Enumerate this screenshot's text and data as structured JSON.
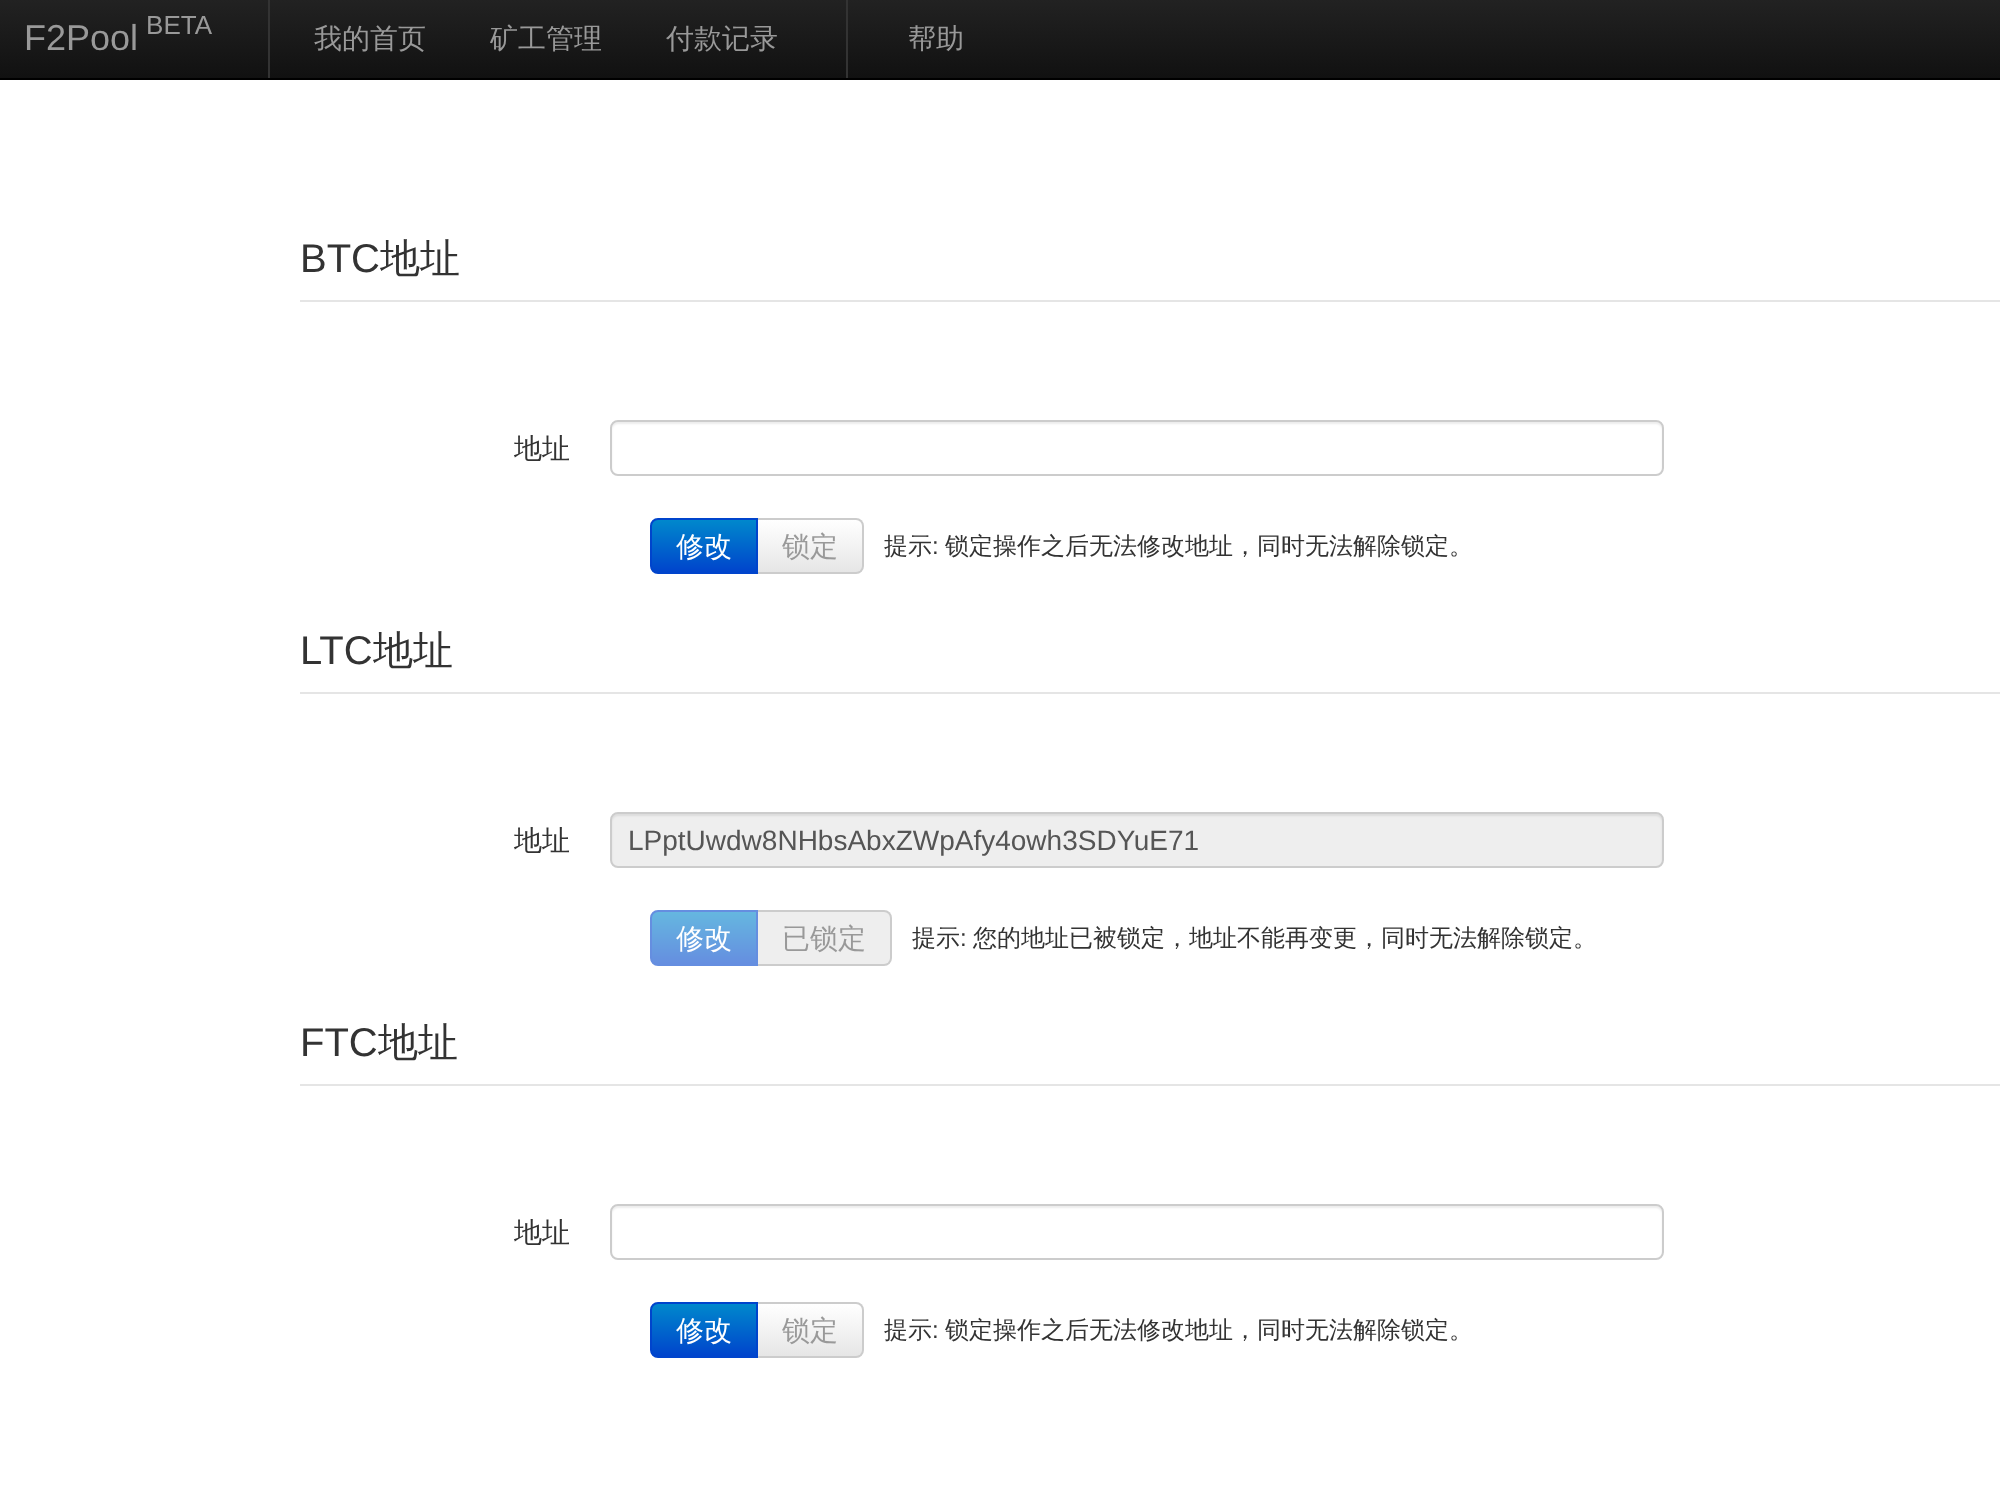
{
  "navbar": {
    "brand": "F2Pool",
    "brand_tag": "BETA",
    "items": [
      {
        "label": "我的首页",
        "kind": "link"
      },
      {
        "label": "矿工管理",
        "kind": "link"
      },
      {
        "label": "付款记录",
        "kind": "link"
      },
      {
        "label": "帮助",
        "kind": "separated"
      }
    ]
  },
  "sections": [
    {
      "heading": "BTC地址",
      "field": {
        "label": "地址"
      },
      "locked": false,
      "buttons": [
        {
          "label": "修改",
          "kind": "primary"
        },
        {
          "label": "锁定",
          "kind": "default"
        }
      ],
      "hint": "提示: 锁定操作之后无法修改地址，同时无法解除锁定。"
    },
    {
      "heading": "LTC地址",
      "field": {
        "label": "地址",
        "value": "LPptUwdw8NHbsAbxZWpAfy4owh3SDYuE71"
      },
      "locked": true,
      "buttons": [
        {
          "label": "修改",
          "kind": "primary"
        },
        {
          "label": "已锁定",
          "kind": "default"
        }
      ],
      "hint": "提示: 您的地址已被锁定，地址不能再变更，同时无法解除锁定。"
    },
    {
      "heading": "FTC地址",
      "field": {
        "label": "地址"
      },
      "locked": false,
      "buttons": [
        {
          "label": "修改",
          "kind": "primary"
        },
        {
          "label": "锁定",
          "kind": "default"
        }
      ],
      "hint": "提示: 锁定操作之后无法修改地址，同时无法解除锁定。"
    }
  ]
}
